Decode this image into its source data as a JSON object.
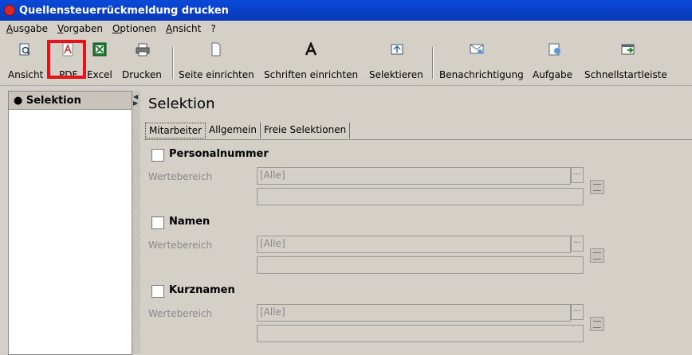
{
  "window": {
    "title": "Quellensteuerrückmeldung drucken"
  },
  "menu": [
    "Ausgabe",
    "Vorgaben",
    "Optionen",
    "Ansicht",
    "?"
  ],
  "toolbar": {
    "items": [
      "Ansicht",
      "PDF",
      "Excel",
      "Drucken",
      "Seite einrichten",
      "Schriften einrichten",
      "Selektieren",
      "Benachrichtigung",
      "Aufgabe",
      "Schnellstartleiste"
    ]
  },
  "left_panel": {
    "item": "● Selektion"
  },
  "main": {
    "heading": "Selektion",
    "tabs": [
      "Mitarbeiter",
      "Allgemein",
      "Freie Selektionen"
    ],
    "sections": [
      {
        "title": "Personalnummer",
        "range_label": "Wertebereich",
        "value": "[Alle]"
      },
      {
        "title": "Namen",
        "range_label": "Wertebereich",
        "value": "[Alle]"
      },
      {
        "title": "Kurznamen",
        "range_label": "Wertebereich",
        "value": "[Alle]"
      }
    ],
    "dots_label": "..."
  },
  "colors": {
    "title_bar": "#0a4ad8",
    "highlight": "#e8121a"
  }
}
